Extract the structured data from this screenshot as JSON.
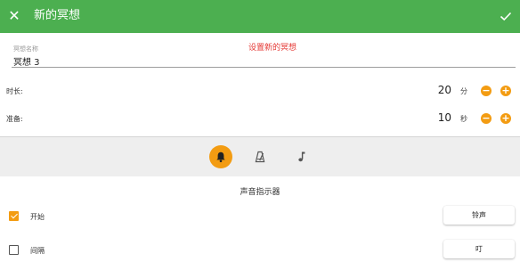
{
  "appbar": {
    "title": "新的冥想",
    "color": "#4caf50",
    "close_icon": "close-icon",
    "confirm_icon": "check-icon"
  },
  "form": {
    "name_label": "冥想名称",
    "name_value": "冥想 3",
    "hint": "设置新的冥想"
  },
  "duration": {
    "label": "时长:",
    "value": "20",
    "unit": "分"
  },
  "preparation": {
    "label": "准备:",
    "value": "10",
    "unit": "秒"
  },
  "stepper": {
    "decrement_symbol": "−",
    "increment_symbol": "+",
    "color": "#f39c12"
  },
  "tabs": [
    {
      "icon": "bell-icon",
      "active": true
    },
    {
      "icon": "metronome-icon",
      "active": false
    },
    {
      "icon": "music-note-icon",
      "active": false
    }
  ],
  "section": {
    "title": "声音指示器"
  },
  "indicators": [
    {
      "label": "开始",
      "checked": true,
      "sound": "铃声"
    },
    {
      "label": "间隔",
      "checked": false,
      "sound": "叮"
    }
  ]
}
